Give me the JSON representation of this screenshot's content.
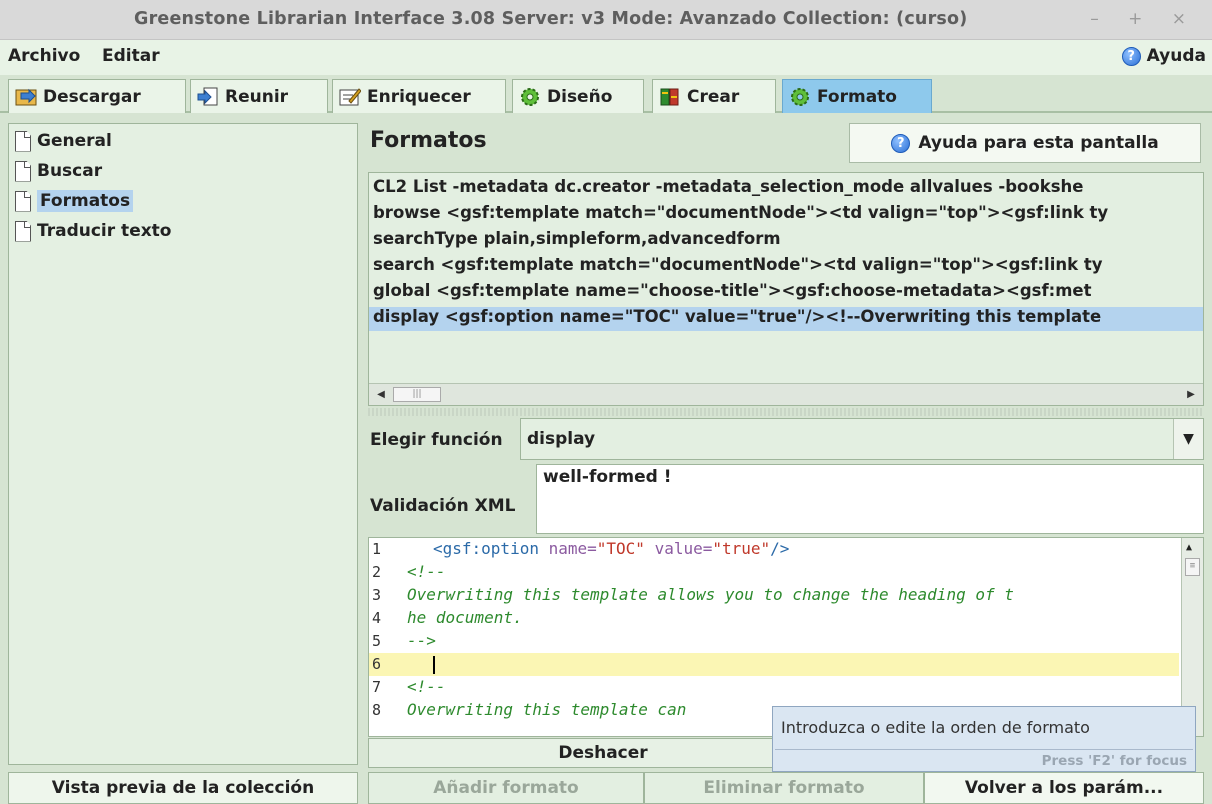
{
  "window": {
    "title": "Greenstone Librarian Interface 3.08  Server: v3  Mode: Avanzado  Collection:  (curso)",
    "controls": "– + ×"
  },
  "menubar": {
    "archivo": "Archivo",
    "editar": "Editar",
    "ayuda": "Ayuda"
  },
  "tabs": [
    {
      "label": "Descargar"
    },
    {
      "label": "Reunir"
    },
    {
      "label": "Enriquecer"
    },
    {
      "label": "Diseño"
    },
    {
      "label": "Crear"
    },
    {
      "label": "Formato"
    }
  ],
  "sidebar": {
    "items": [
      {
        "label": "General"
      },
      {
        "label": "Buscar"
      },
      {
        "label": "Formatos"
      },
      {
        "label": "Traducir texto"
      }
    ],
    "preview_button": "Vista previa de la colección"
  },
  "main": {
    "title": "Formatos",
    "help_button": "Ayuda para esta pantalla",
    "format_list": [
      "CL2  List -metadata dc.creator -metadata_selection_mode allvalues -bookshe",
      "browse <gsf:template match=\"documentNode\"><td valign=\"top\"><gsf:link ty",
      "searchType plain,simpleform,advancedform",
      "search <gsf:template match=\"documentNode\"><td valign=\"top\"><gsf:link ty",
      "global <gsf:template name=\"choose-title\"><gsf:choose-metadata><gsf:met",
      "display <gsf:option name=\"TOC\" value=\"true\"/><!--Overwriting this template"
    ],
    "function_label": "Elegir función",
    "function_value": "display",
    "xml_label": "Validación XML",
    "xml_value": "well-formed !",
    "editor": {
      "line_numbers": [
        "1",
        "2",
        "3",
        "4",
        "5",
        "6",
        "7",
        "8"
      ],
      "l1_open": "<gsf:option",
      "l1_attr1": " name=",
      "l1_val1": "\"TOC\"",
      "l1_attr2": " value=",
      "l1_val2": "\"true\"",
      "l1_close": "/>",
      "l2": "<!--",
      "l3": "Overwriting this template allows you to change the heading of t",
      "l4": "he document.",
      "l5": "-->",
      "l7": "<!--",
      "l8": "Overwriting this template can"
    },
    "undo_button": "Deshacer",
    "tooltip": {
      "text": "Introduzca o edite la orden de formato",
      "hint": "Press 'F2' for focus"
    },
    "add_button": "Añadir formato",
    "remove_button": "Eliminar formato",
    "reset_button": "Volver a los parám..."
  },
  "colors": {
    "active_tab": "#8ec9ec",
    "selection": "#b4d3ee",
    "panel_bg": "#d6e4d2",
    "current_line": "#fbf6b4"
  }
}
